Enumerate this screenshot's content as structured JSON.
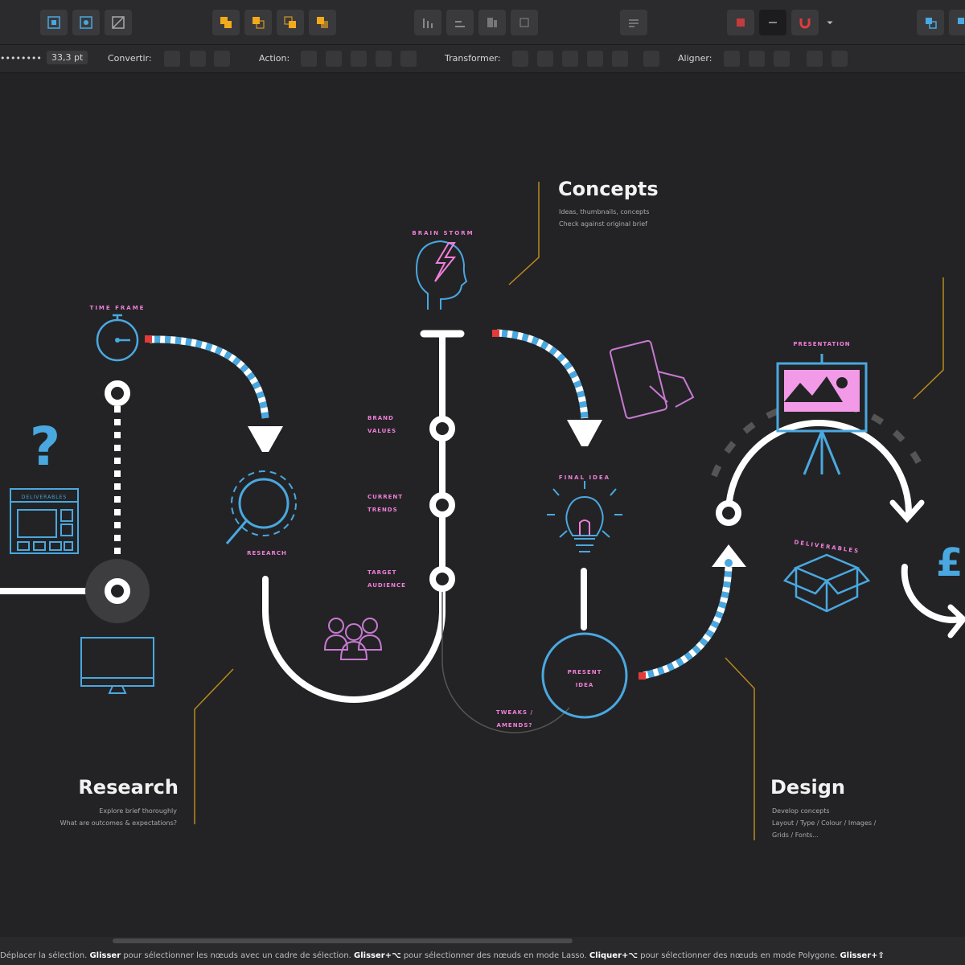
{
  "context_toolbar": {
    "size_value": "33,3 pt",
    "convert_label": "Convertir:",
    "action_label": "Action:",
    "transform_label": "Transformer:",
    "align_label": "Aligner:"
  },
  "diagram": {
    "concepts": {
      "title": "Concepts",
      "line1": "Ideas, thumbnails, concepts",
      "line2": "Check against original brief"
    },
    "research": {
      "title": "Research",
      "line1": "Explore brief thoroughly",
      "line2": "What are outcomes & expectations?"
    },
    "design": {
      "title": "Design",
      "line1": "Develop concepts",
      "line2": "Layout / Type / Colour / Images /",
      "line3": "Grids / Fonts..."
    },
    "labels": {
      "time_frame": "TIME FRAME",
      "brain_storm": "BRAIN STORM",
      "deliverables_box": "DELIVERABLES",
      "research_icon": "RESEARCH",
      "brand_values_1": "BRAND",
      "brand_values_2": "VALUES",
      "current_trends_1": "CURRENT",
      "current_trends_2": "TRENDS",
      "target_audience_1": "TARGET",
      "target_audience_2": "AUDIENCE",
      "final_idea": "FINAL IDEA",
      "present_idea_1": "PRESENT",
      "present_idea_2": "IDEA",
      "tweaks_1": "TWEAKS /",
      "tweaks_2": "AMENDS?",
      "presentation": "PRESENTATION",
      "deliverables": "DELIVERABLES",
      "question_mark": "?",
      "pound": "£"
    }
  },
  "status_bar": {
    "part1": "Déplacer la sélection.",
    "key1": "Glisser",
    "part2": "pour sélectionner les nœuds avec un cadre de sélection.",
    "key2": "Glisser+⌥",
    "part3": "pour sélectionner des nœuds en mode Lasso.",
    "key3": "Cliquer+⌥",
    "part4": "pour sélectionner des nœuds en mode Polygone.",
    "key4": "Glisser+⇧"
  }
}
